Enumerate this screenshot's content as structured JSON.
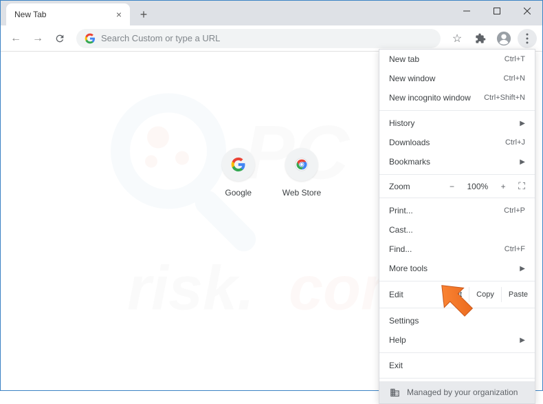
{
  "tab": {
    "title": "New Tab"
  },
  "omnibox": {
    "placeholder": "Search Custom or type a URL"
  },
  "shortcuts": [
    {
      "label": "Google"
    },
    {
      "label": "Web Store"
    }
  ],
  "menu": {
    "new_tab": {
      "label": "New tab",
      "shortcut": "Ctrl+T"
    },
    "new_window": {
      "label": "New window",
      "shortcut": "Ctrl+N"
    },
    "new_incognito": {
      "label": "New incognito window",
      "shortcut": "Ctrl+Shift+N"
    },
    "history": {
      "label": "History"
    },
    "downloads": {
      "label": "Downloads",
      "shortcut": "Ctrl+J"
    },
    "bookmarks": {
      "label": "Bookmarks"
    },
    "zoom": {
      "label": "Zoom",
      "value": "100%"
    },
    "print": {
      "label": "Print...",
      "shortcut": "Ctrl+P"
    },
    "cast": {
      "label": "Cast..."
    },
    "find": {
      "label": "Find...",
      "shortcut": "Ctrl+F"
    },
    "more_tools": {
      "label": "More tools"
    },
    "edit": {
      "label": "Edit",
      "cut": "Cut",
      "copy": "Copy",
      "paste": "Paste"
    },
    "settings": {
      "label": "Settings"
    },
    "help": {
      "label": "Help"
    },
    "exit": {
      "label": "Exit"
    },
    "managed": {
      "label": "Managed by your organization"
    }
  }
}
